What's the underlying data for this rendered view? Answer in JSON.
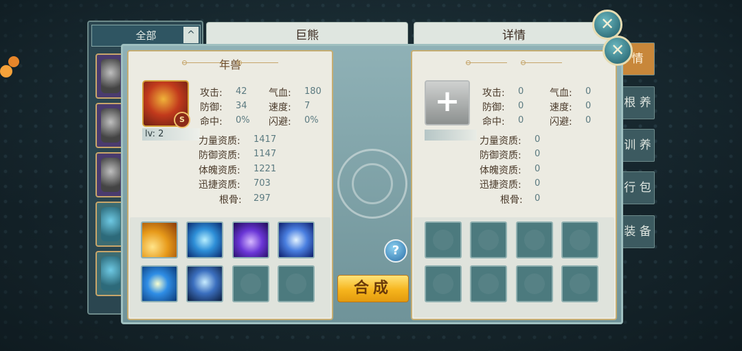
{
  "list": {
    "header": "全部",
    "arrow": "^"
  },
  "back_tabs": {
    "left": "巨熊",
    "right": "详情"
  },
  "side_tabs": [
    "情",
    "根 养",
    "训 养",
    "行 包",
    "装 备"
  ],
  "left_card": {
    "title": "年兽",
    "badge": "S",
    "level": "lv: 2",
    "stats": {
      "attack_label": "攻击:",
      "attack": "42",
      "hp_label": "气血:",
      "hp": "180",
      "defense_label": "防御:",
      "defense": "34",
      "speed_label": "速度:",
      "speed": "7",
      "hit_label": "命中:",
      "hit": "0%",
      "dodge_label": "闪避:",
      "dodge": "0%"
    },
    "aptitudes": [
      {
        "label": "力量资质:",
        "value": "1417"
      },
      {
        "label": "防御资质:",
        "value": "1147"
      },
      {
        "label": "体魄资质:",
        "value": "1221"
      },
      {
        "label": "迅捷资质:",
        "value": "703"
      },
      {
        "label": "根骨:",
        "value": "297"
      }
    ],
    "skills": [
      "skill-icon-1",
      "skill-icon-2",
      "skill-icon-3",
      "skill-icon-4",
      "skill-icon-5",
      "skill-icon-6"
    ]
  },
  "right_card": {
    "plus": "+",
    "stats": {
      "attack_label": "攻击:",
      "attack": "0",
      "hp_label": "气血:",
      "hp": "0",
      "defense_label": "防御:",
      "defense": "0",
      "speed_label": "速度:",
      "speed": "0",
      "hit_label": "命中:",
      "hit": "0",
      "dodge_label": "闪避:",
      "dodge": "0"
    },
    "aptitudes": [
      {
        "label": "力量资质:",
        "value": "0"
      },
      {
        "label": "防御资质:",
        "value": "0"
      },
      {
        "label": "体魄资质:",
        "value": "0"
      },
      {
        "label": "迅捷资质:",
        "value": "0"
      },
      {
        "label": "根骨:",
        "value": "0"
      }
    ]
  },
  "middle": {
    "help": "?",
    "combine_label": "合成"
  },
  "close_icon": "✕",
  "colors": {
    "accent": "#f6b51d",
    "card_bg": "#ecebe2",
    "panel": "#8fb1b6"
  }
}
